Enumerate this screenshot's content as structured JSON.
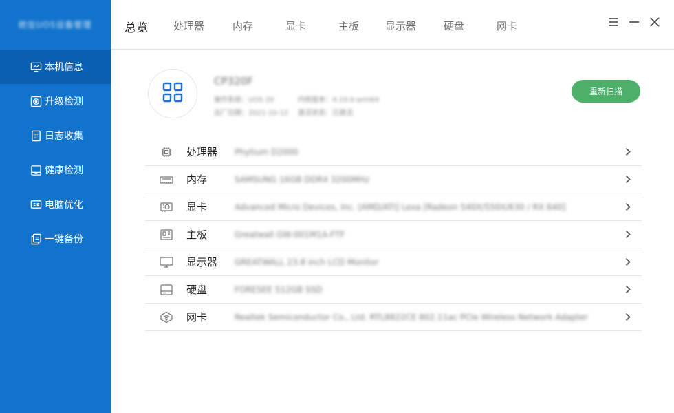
{
  "sidebar": {
    "brand": "统信UOS设备管理",
    "items": [
      {
        "label": "本机信息",
        "icon": "monitor-icon"
      },
      {
        "label": "升级检测",
        "icon": "upgrade-icon"
      },
      {
        "label": "日志收集",
        "icon": "log-icon"
      },
      {
        "label": "健康检测",
        "icon": "health-icon"
      },
      {
        "label": "电脑优化",
        "icon": "optimize-icon"
      },
      {
        "label": "一键备份",
        "icon": "backup-icon"
      }
    ]
  },
  "tabs": [
    "总览",
    "处理器",
    "内存",
    "显卡",
    "主板",
    "显示器",
    "硬盘",
    "网卡"
  ],
  "summary": {
    "model": "CP320F",
    "meta": [
      "操作系统：UOS 20",
      "内核版本：4.19.0-arm64",
      "出厂日期：2021-10-12",
      "激活状态：已激活"
    ],
    "rescan_label": "重新扫描"
  },
  "devices": [
    {
      "label": "处理器",
      "value": "Phytium D2000",
      "icon": "cpu-icon"
    },
    {
      "label": "内存",
      "value": "SAMSUNG 16GB DDR4 3200MHz",
      "icon": "memory-icon"
    },
    {
      "label": "显卡",
      "value": "Advanced Micro Devices, Inc. [AMD/ATI] Lexa [Radeon 540X/550X/630 / RX 640]",
      "icon": "gpu-icon"
    },
    {
      "label": "主板",
      "value": "Greatwall GW-001M1A-FTF",
      "icon": "motherboard-icon"
    },
    {
      "label": "显示器",
      "value": "GREATWALL 23.8 inch LCD Monitor",
      "icon": "display-icon"
    },
    {
      "label": "硬盘",
      "value": "FORESEE 512GB SSD",
      "icon": "disk-icon"
    },
    {
      "label": "网卡",
      "value": "Realtek Semiconductor Co., Ltd. RTL8822CE 802.11ac PCIe Wireless Network Adapter",
      "icon": "wifi-icon"
    }
  ],
  "colors": {
    "sidebar_bg": "#1173cc",
    "sidebar_active": "#0a5fb0",
    "accent_green": "#4caf6a",
    "icon_blue": "#1b6fd1"
  }
}
